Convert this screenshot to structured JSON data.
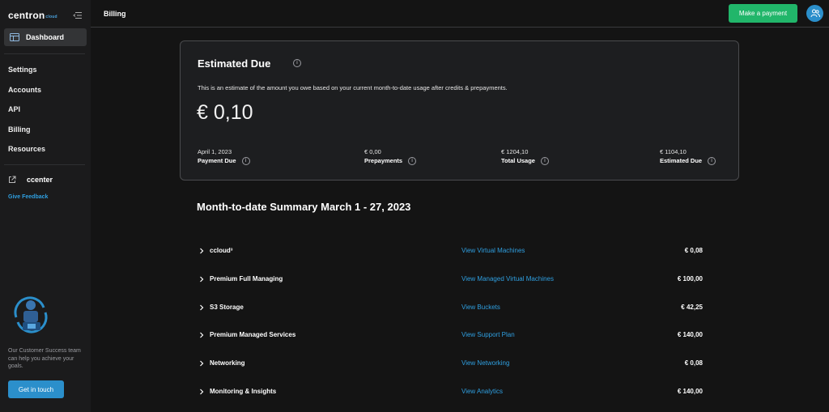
{
  "sidebar": {
    "brand": "centron",
    "brand_sub": "cloud",
    "dashboard_label": "Dashboard",
    "nav": [
      "Settings",
      "Accounts",
      "API",
      "Billing",
      "Resources"
    ],
    "ccenter_label": "ccenter",
    "feedback_label": "Give Feedback",
    "support_text": "Our Customer Success team can help you achieve your goals.",
    "touch_button": "Get in touch"
  },
  "topbar": {
    "title": "Billing",
    "pay_button": "Make a payment"
  },
  "estimate": {
    "title": "Estimated Due",
    "description": "This is an estimate of the amount you owe based on your current month-to-date usage after credits & prepayments.",
    "amount": "€ 0,10",
    "stats": [
      {
        "value": "April 1, 2023",
        "label": "Payment Due"
      },
      {
        "value": "€ 0,00",
        "label": "Prepayments"
      },
      {
        "value": "€ 1204,10",
        "label": "Total Usage"
      },
      {
        "value": "€ 1104,10",
        "label": "Estimated Due"
      }
    ]
  },
  "summary": {
    "title": "Month-to-date Summary March 1 - 27, 2023",
    "rows": [
      {
        "name": "ccloud³",
        "link": "View Virtual Machines",
        "amount": "€ 0,08"
      },
      {
        "name": "Premium Full Managing",
        "link": "View Managed Virtual Machines",
        "amount": "€ 100,00"
      },
      {
        "name": "S3 Storage",
        "link": "View Buckets",
        "amount": "€ 42,25"
      },
      {
        "name": "Premium Managed Services",
        "link": "View Support Plan",
        "amount": "€ 140,00"
      },
      {
        "name": "Networking",
        "link": "View Networking",
        "amount": "€ 0,08"
      },
      {
        "name": "Monitoring & Insights",
        "link": "View Analytics",
        "amount": "€ 140,00"
      }
    ]
  },
  "colors": {
    "accent_blue": "#2b8fcb",
    "link_blue": "#2f9fe0",
    "pay_green": "#21b66a",
    "background": "#141414",
    "sidebar": "#1b1b1c"
  }
}
